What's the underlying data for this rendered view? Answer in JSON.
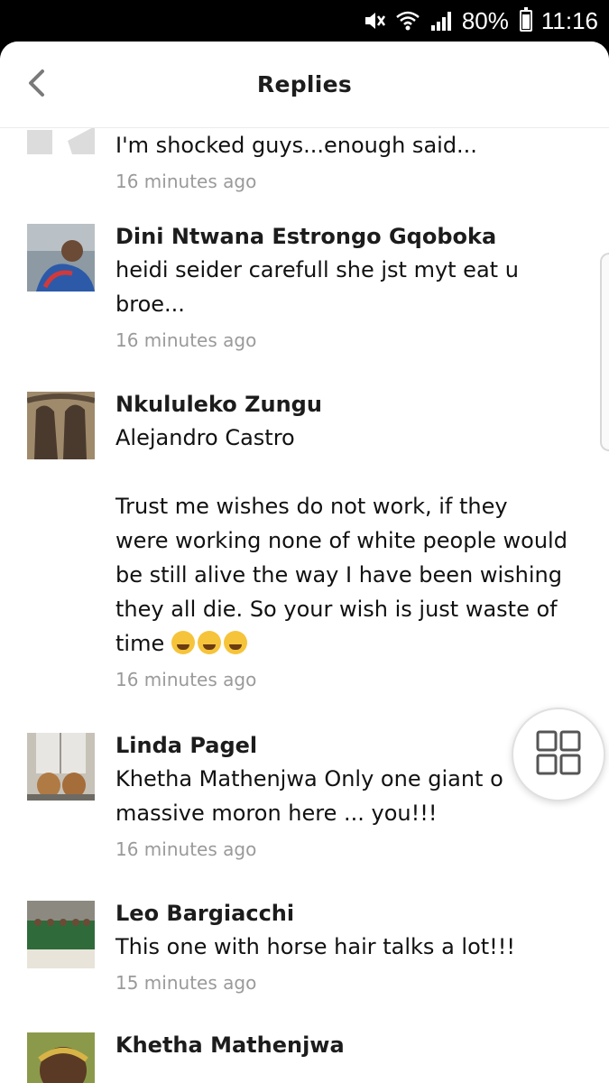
{
  "status_bar": {
    "battery": "80%",
    "time": "11:16",
    "icons": [
      "mute-icon",
      "wifi-icon",
      "signal-icon",
      "battery-icon"
    ]
  },
  "header": {
    "title": "Replies",
    "back_icon": "chevron-left-icon"
  },
  "replies": [
    {
      "author": "",
      "text": "I'm shocked guys...enough said...",
      "time": "16 minutes ago"
    },
    {
      "author": "Dini Ntwana Estrongo Gqoboka",
      "text": "heidi seider carefull she jst myt eat u\nbroe...",
      "time": "16 minutes ago"
    },
    {
      "author": "Nkululeko Zungu",
      "text": "Alejandro Castro\n\nTrust me wishes do not work, if they\nwere working none of white people would\nbe still alive the way I have been wishing\nthey all die. So your wish is just waste of\ntime",
      "emoji_count": 3,
      "time": "16 minutes ago"
    },
    {
      "author": "Linda Pagel",
      "text": "Khetha Mathenjwa Only one giant o\nmassive moron here ... you!!!",
      "time": "16 minutes ago"
    },
    {
      "author": "Leo Bargiacchi",
      "text": "This one with horse hair talks a lot!!!",
      "time": "15 minutes ago"
    },
    {
      "author": "Khetha Mathenjwa",
      "text": "",
      "time": ""
    }
  ],
  "fab": {
    "icon": "grid-icon"
  },
  "colors": {
    "background": "#ffffff",
    "text": "#111111",
    "timestamp": "#9a9a9a",
    "status_bar": "#000000"
  }
}
